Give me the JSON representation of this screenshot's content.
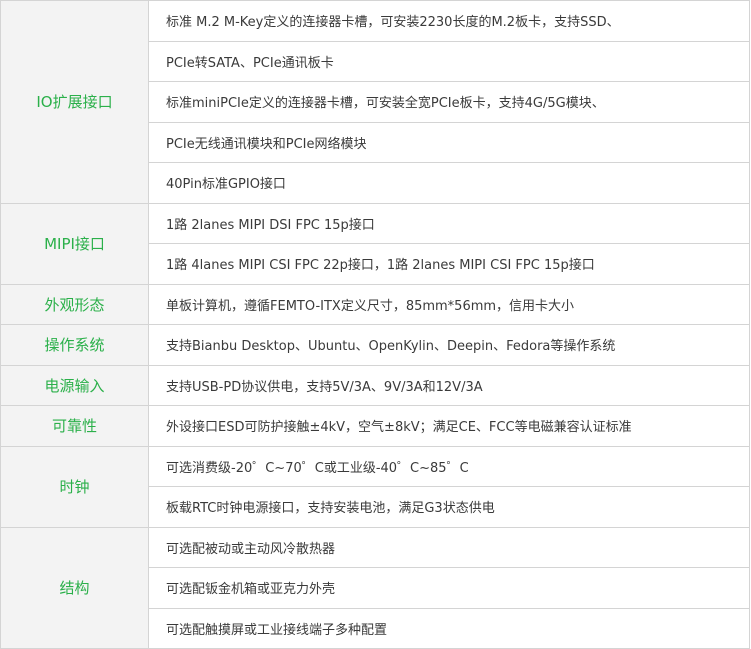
{
  "sections": [
    {
      "category": "IO扩展接口",
      "lines": [
        "标准 M.2 M-Key定义的连接器卡槽，可安装2230长度的M.2板卡，支持SSD、",
        "PCIe转SATA、PCIe通讯板卡",
        "标准miniPCIe定义的连接器卡槽，可安装全宽PCIe板卡，支持4G/5G模块、",
        "PCIe无线通讯模块和PCIe网络模块",
        "40Pin标准GPIO接口"
      ]
    },
    {
      "category": "MIPI接口",
      "lines": [
        "1路 2lanes MIPI DSI FPC 15p接口",
        "1路 4lanes MIPI CSI FPC 22p接口，1路 2lanes MIPI CSI  FPC 15p接口"
      ]
    },
    {
      "category": "外观形态",
      "lines": [
        "单板计算机，遵循FEMTO-ITX定义尺寸，85mm*56mm，信用卡大小"
      ]
    },
    {
      "category": "操作系统",
      "lines": [
        "支持Bianbu Desktop、Ubuntu、OpenKylin、Deepin、Fedora等操作系统"
      ]
    },
    {
      "category": "电源输入",
      "lines": [
        "支持USB-PD协议供电，支持5V/3A、9V/3A和12V/3A"
      ]
    },
    {
      "category": "可靠性",
      "lines": [
        "外设接口ESD可防护接触±4kV，空气±8kV；满足CE、FCC等电磁兼容认证标准"
      ]
    },
    {
      "category": "时钟",
      "lines": [
        "可选消费级-20゜C~70゜C或工业级-40゜C~85゜C",
        "板载RTC时钟电源接口，支持安装电池，满足G3状态供电"
      ]
    },
    {
      "category": "结构",
      "lines": [
        "可选配被动或主动风冷散热器",
        "可选配钣金机箱或亚克力外壳",
        "可选配触摸屏或工业接线端子多种配置"
      ]
    }
  ]
}
